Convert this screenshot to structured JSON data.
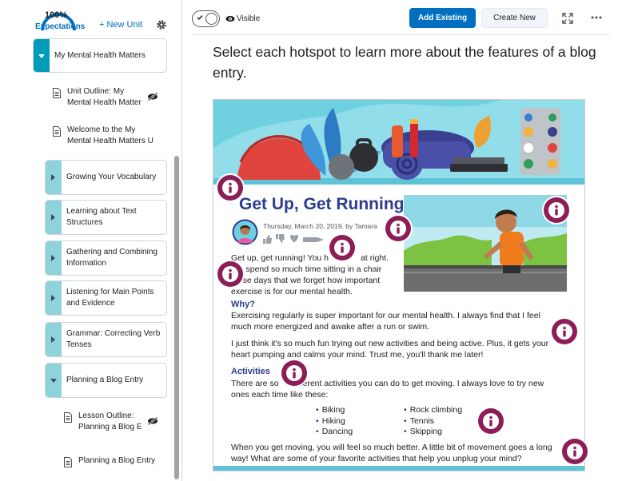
{
  "sidebar": {
    "progress_percent": "100%",
    "progress_label": "Expectations",
    "new_unit_label": "+ New Unit",
    "settings_icon": "gear-icon",
    "units": [
      {
        "label": "My Mental Health Matters",
        "state": "expanded"
      },
      {
        "label": "Growing Your Vocabulary",
        "state": "collapsed"
      },
      {
        "label": "Learning about Text Structures",
        "state": "collapsed"
      },
      {
        "label": "Gathering and Combining Information",
        "state": "collapsed"
      },
      {
        "label": "Listening for Main Points and Evidence",
        "state": "collapsed"
      },
      {
        "label": "Grammar: Correcting Verb Tenses",
        "state": "collapsed"
      },
      {
        "label": "Planning a Blog Entry",
        "state": "expanded"
      }
    ],
    "topics": [
      {
        "line1": "Unit Outline: My",
        "line2": "Mental Health Matter",
        "hidden": true
      },
      {
        "line1": "Welcome to the My",
        "line2": "Mental Health Matters U",
        "hidden": false
      },
      {
        "line1": "Lesson Outline:",
        "line2": "Planning a Blog En",
        "hidden": true
      },
      {
        "line1": "Planning a Blog Entry",
        "line2": "",
        "hidden": false
      }
    ]
  },
  "header": {
    "visibility_label": "Visible",
    "visibility_on": true,
    "add_existing_label": "Add Existing",
    "create_new_label": "Create New",
    "colors": {
      "primary": "#006fbf",
      "hotspot": "#8c1d57"
    }
  },
  "content": {
    "instruction": "Select each hotspot to learn more about the features of a blog entry.",
    "blog": {
      "title": "Get Up, Get Running!",
      "meta": "Thursday, March 20, 2019, by Tamara",
      "intro_lines": [
        "Get up, get running! You h",
        "at right.",
        "We spend so much time sitting in a chair",
        "these days that we forget how important",
        "exercise is for our mental health."
      ],
      "why_heading": "Why?",
      "why_p1": [
        "Exercising regularly is super important for our mental health. I always find that I feel",
        "much more energized and awake after a run or swim."
      ],
      "why_p2": [
        "I just think it's so much fun trying out new activities and being active. Plus, it gets your",
        "heart pumping and calms your mind. Trust me, you'll thank me later!"
      ],
      "activities_heading": "Activities",
      "activities_p": [
        "There are so",
        "ifferent activities you can do to get moving. I always love to try new",
        "ones each time like these:"
      ],
      "list_left": [
        "Biking",
        "Hiking",
        "Dancing"
      ],
      "list_right": [
        "Rock climbing",
        "Tennis",
        "Skipping"
      ],
      "closing": [
        "When you get moving, you will feel so much better. A little bit of movement goes a long",
        "way! What are some of your favorite activities that help you unplug your mind?"
      ]
    },
    "hotspot_icon": "info-icon"
  }
}
